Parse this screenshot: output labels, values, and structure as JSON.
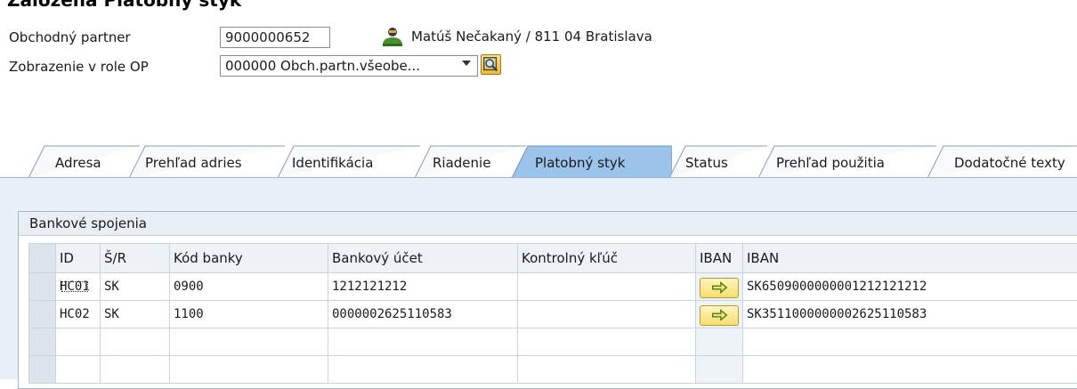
{
  "title": "Založená Platobný styk",
  "header": {
    "bp_label": "Obchodný partner",
    "bp_value": "9000000652",
    "person_name": "Matúš Nečakaný / 811 04 Bratislava",
    "role_label": "Zobrazenie v role OP",
    "role_value": "000000 Obch.partn.všeobe..."
  },
  "tabs": [
    {
      "label": "Adresa"
    },
    {
      "label": "Prehľad adries"
    },
    {
      "label": "Identifikácia"
    },
    {
      "label": "Riadenie"
    },
    {
      "label": "Platobný styk",
      "active": true
    },
    {
      "label": "Status"
    },
    {
      "label": "Prehľad použitia"
    },
    {
      "label": "Dodatočné texty"
    }
  ],
  "bank": {
    "group_title": "Bankové spojenia",
    "columns": [
      "ID",
      "Š/R",
      "Kód banky",
      "Bankový účet",
      "Kontrolný kľúč",
      "IBAN",
      "IBAN"
    ],
    "rows": [
      {
        "id": "HC01",
        "country": "SK",
        "bank_code": "0900",
        "account": "1212121212",
        "control_key": "",
        "iban": "SK6509000000001212121212"
      },
      {
        "id": "HC02",
        "country": "SK",
        "bank_code": "1100",
        "account": "0000002625110583",
        "control_key": "",
        "iban": "SK3511000000002625110583"
      }
    ]
  },
  "colors": {
    "active_tab": "#9cc3ea",
    "panel_bg": "#e7eff7",
    "iban_button": "#f6dd6f"
  }
}
